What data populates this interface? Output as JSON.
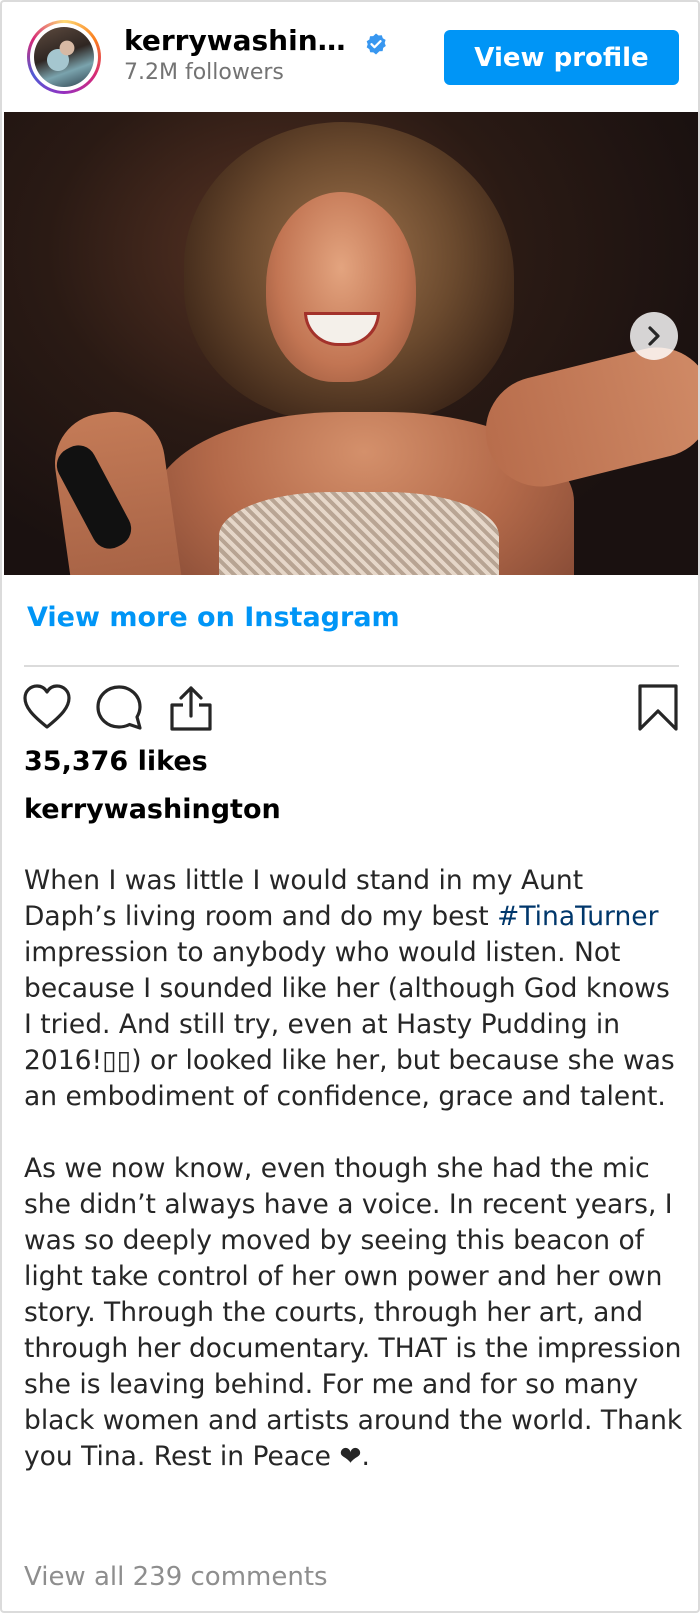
{
  "header": {
    "username": "kerrywashin…",
    "followers": "7.2M followers",
    "view_profile_label": "View profile"
  },
  "post": {
    "view_more_label": "View more on Instagram",
    "likes": "35,376 likes",
    "caption_user": "kerrywashington",
    "caption_p1_before": "When I was little I would stand in my Aunt Daph’s living room and do my best ",
    "hashtag": "#TinaTurner",
    "caption_p1_after": " impression to anybody who would listen. Not because I sounded like her (although God knows I tried. And still try, even at Hasty Pudding in 2016!▯▯) or looked like her, but because she was an embodiment of confidence, grace and talent.",
    "caption_p2": "As we now know, even though she had the mic she didn’t always have a voice. In recent years, I was so deeply moved by seeing this beacon of light take control of her own power and her own story. Through the courts, through her art, and through her documentary. THAT is the impression she is leaving behind. For me and for so many black women and artists around the world. Thank you Tina. Rest in Peace ❤.",
    "view_comments": "View all 239 comments"
  },
  "icons": {
    "avatar": "profile-avatar",
    "verified": "verified-badge-icon",
    "next": "chevron-right-icon",
    "like": "heart-icon",
    "comment": "comment-bubble-icon",
    "share": "share-icon",
    "save": "bookmark-icon"
  },
  "colors": {
    "accent": "#0095f6",
    "hashtag": "#00376b",
    "muted": "#737373",
    "border": "#dbdbdb"
  }
}
